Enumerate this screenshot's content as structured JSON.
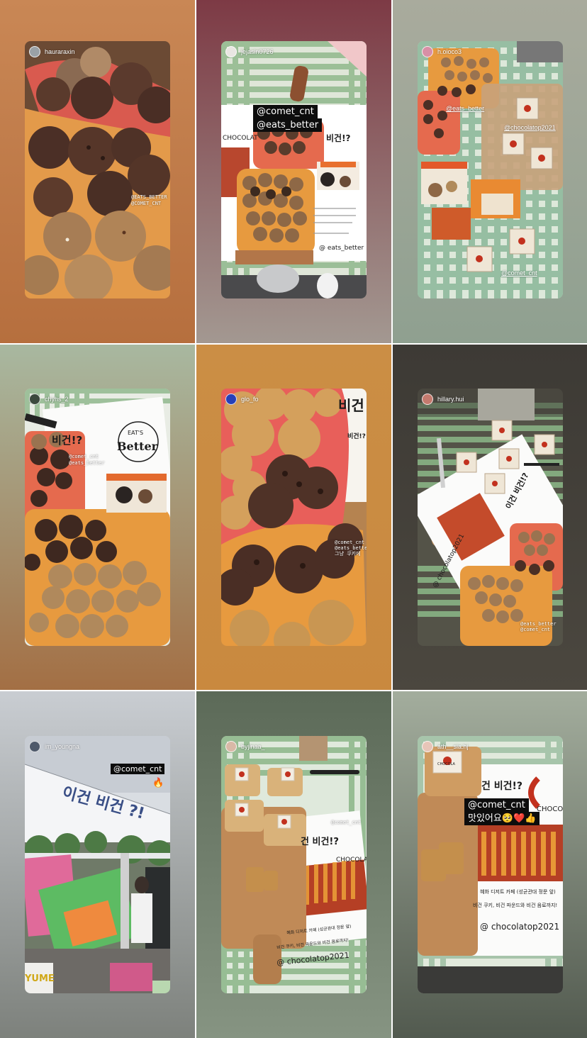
{
  "stories": [
    {
      "username": "hauraraxin",
      "background": [
        "#c98755",
        "#b66f3e"
      ],
      "avatar_color": "#9aa1a6",
      "tags": [
        "@EATS_BETTER",
        "@COMET_CNT"
      ]
    },
    {
      "username": "jejasin0726",
      "background": [
        "#7d3a45",
        "#a39891"
      ],
      "avatar_color": "#e9e6e2",
      "stickers": [
        "@comet_cnt",
        "@eats_better"
      ],
      "print_texts": [
        "CHOCOLAT",
        "비건!?",
        "@ eats_better"
      ]
    },
    {
      "username": "h.oioco3",
      "background": [
        "#a9ab9d",
        "#8fa090"
      ],
      "avatar_color": "#d88fa6",
      "tags": [
        "@eats_better",
        "@chocolatop2021",
        "@comet_cnt"
      ]
    },
    {
      "username": "chyhs_2",
      "background": [
        "#a8b8a0",
        "#a36f44"
      ],
      "avatar_color": "#3c4a3e",
      "tags": [
        "@comet_cnt",
        "@eats_better"
      ],
      "print_texts": [
        "비건!?",
        "Better",
        "EAT'S"
      ]
    },
    {
      "username": "glo_fo",
      "background": [
        "#cb8e45",
        "#c9893f"
      ],
      "avatar_color": "#2740b8",
      "tags": [
        "@comet_cnt",
        "@eats_better",
        "그냥 쿠키에"
      ],
      "print_texts": [
        "비건",
        "비건!?"
      ]
    },
    {
      "username": "hillary.hui",
      "background": [
        "#3d3a35",
        "#4b473f"
      ],
      "avatar_color": "#c47a6e",
      "tags": [
        "@eats_better",
        "@comet_cnt"
      ],
      "print_texts": [
        "이건 비건!?",
        "@ chocolatop2021"
      ]
    },
    {
      "username": "im_youngna",
      "background": [
        "#c9cdd2",
        "#7d817c"
      ],
      "avatar_color": "#4f5a6b",
      "stickers": [
        "@comet_cnt"
      ],
      "emoji": "🔥",
      "print_texts": [
        "이건 비건 ?!",
        "YUME"
      ]
    },
    {
      "username": "byjinaa_",
      "background": [
        "#5c6a58",
        "#869482"
      ],
      "avatar_color": "#d9b9a7",
      "tags": [
        "@comet_cnt"
      ],
      "print_texts": [
        "건 비건!?",
        "CHOCOLA",
        "혜화 디저트 카페 (성균관대 정문 앞)",
        "비건 쿠키, 비건 파운드와 비건 음료까지!",
        "@ chocolatop2021"
      ]
    },
    {
      "username": "ath__sia.hj",
      "background": [
        "#a3ad9d",
        "#525a4f"
      ],
      "avatar_color": "#e7c5b8",
      "stickers": [
        "@comet_cnt",
        "맛있어요🥺❤️👍"
      ],
      "print_texts": [
        "건 비건!?",
        "CHOCOLAT",
        "혜화 디저트 카페 (성균관대 정문 앞)",
        "비건 쿠키, 비건 파운드와 비건 음료까지!",
        "@ chocolatop2021",
        "CHOCOLA"
      ]
    }
  ]
}
